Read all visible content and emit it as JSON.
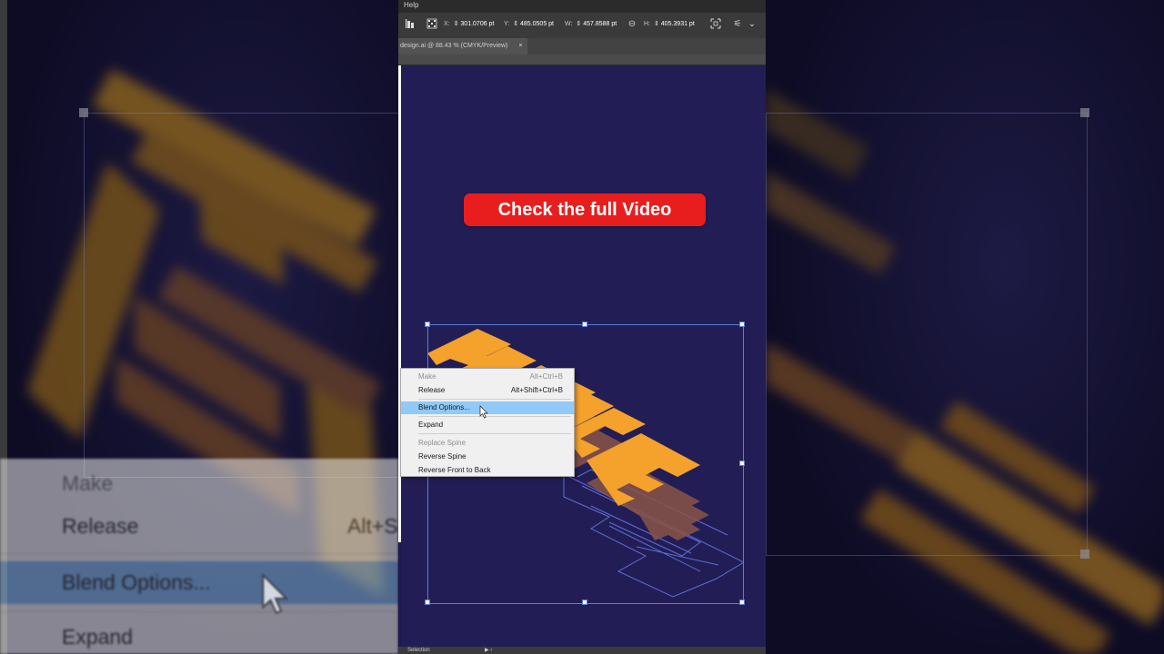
{
  "menubar": {
    "help": "Help"
  },
  "controlbar": {
    "x_label": "X:",
    "x_value": "301.0706 pt",
    "y_label": "Y:",
    "y_value": "485.0505 pt",
    "w_label": "W:",
    "w_value": "457.8588 pt",
    "h_label": "H:",
    "h_value": "405.3931 pt"
  },
  "document_tab": {
    "title": "design.ai @ 88.43 % (CMYK/Preview)",
    "close": "×"
  },
  "artboard": {
    "cta_text": "Check the full Video",
    "artwork_text": "SMILE"
  },
  "context_menu": {
    "items": [
      {
        "label": "Make",
        "shortcut": "Alt+Ctrl+B",
        "disabled": true
      },
      {
        "label": "Release",
        "shortcut": "Alt+Shift+Ctrl+B",
        "disabled": false
      },
      {
        "label": "Blend Options...",
        "shortcut": "",
        "highlighted": true
      },
      {
        "label": "Expand",
        "shortcut": "",
        "disabled": false
      },
      {
        "label": "Replace Spine",
        "shortcut": "",
        "disabled": true
      },
      {
        "label": "Reverse Spine",
        "shortcut": "",
        "disabled": false
      },
      {
        "label": "Reverse Front to Back",
        "shortcut": "",
        "disabled": false
      }
    ]
  },
  "background_zoom_menu": {
    "make": "Make",
    "release": "Release",
    "release_shortcut": "Alt+S",
    "blend_options": "Blend Options...",
    "expand": "Expand"
  },
  "statusbar": {
    "tool": "Selection"
  },
  "colors": {
    "artboard_bg": "#231d55",
    "cta_red": "#e81e1e",
    "smile_orange": "#f4a22c",
    "shadow_brown": "#8a5548",
    "outline_blue": "#5a6fd8",
    "menu_highlight": "#91c9f7"
  },
  "icons": [
    "align-icon",
    "reference-point-icon",
    "stepper-icon",
    "link-proportions-icon",
    "transform-icon",
    "dropdown-chevron-icon",
    "close-icon",
    "arrow-cursor-icon"
  ]
}
